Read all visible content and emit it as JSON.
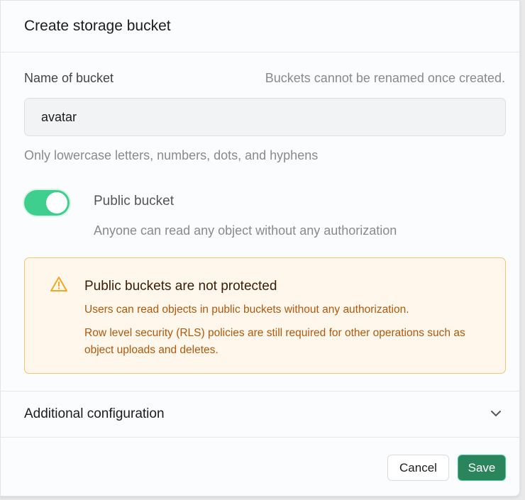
{
  "dialog": {
    "title": "Create storage bucket"
  },
  "name_field": {
    "label": "Name of bucket",
    "note": "Buckets cannot be renamed once created.",
    "value": "avatar",
    "hint": "Only lowercase letters, numbers, dots, and hyphens"
  },
  "public_toggle": {
    "label": "Public bucket",
    "description": "Anyone can read any object without any authorization",
    "checked": true
  },
  "warning": {
    "title": "Public buckets are not protected",
    "line1": "Users can read objects in public buckets without any authorization.",
    "line2": "Row level security (RLS) policies are still required for other operations such as object uploads and deletes."
  },
  "additional": {
    "label": "Additional configuration"
  },
  "buttons": {
    "cancel": "Cancel",
    "save": "Save"
  },
  "colors": {
    "accent": "#3ecf8e",
    "save": "#2b855c",
    "warning_border": "#f4c46e"
  }
}
